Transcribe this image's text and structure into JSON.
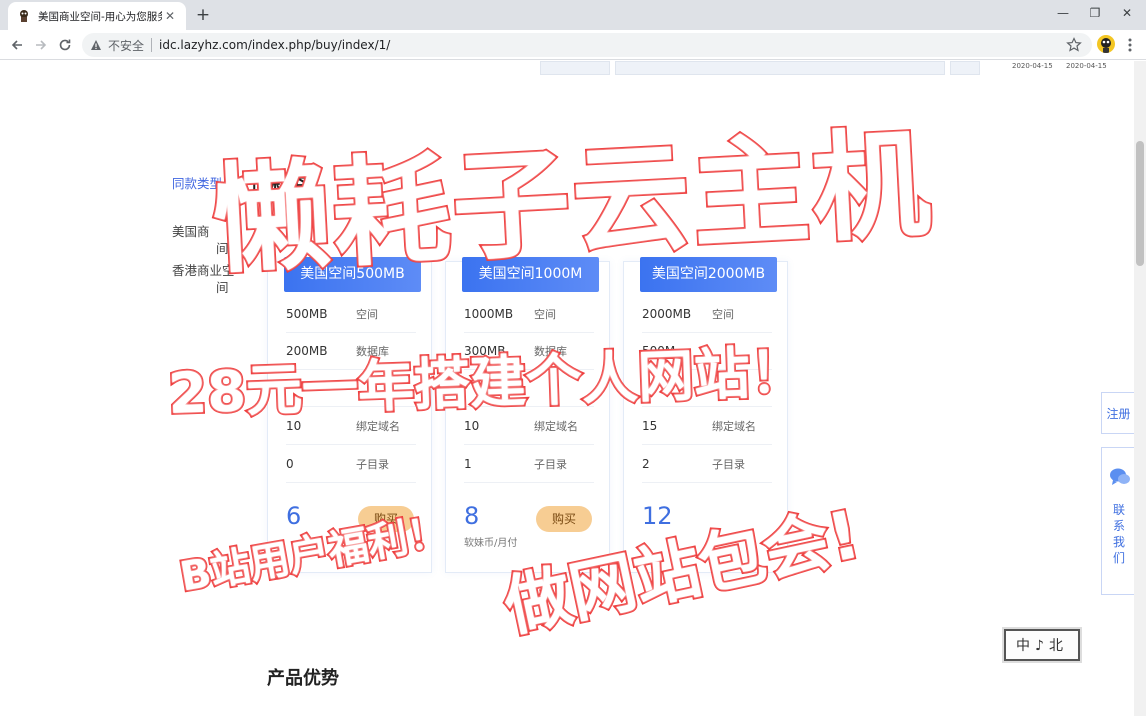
{
  "browser": {
    "tab_title": "美国商业空间-用心为您服务！",
    "new_tab": "+",
    "security_label": "不安全",
    "url": "idc.lazyhz.com/index.php/buy/index/1/",
    "window_min": "—",
    "window_restore": "❐",
    "window_close": "✕",
    "tab_close": "✕"
  },
  "banner": {
    "date1": "2020-04-15",
    "date2": "2020-04-15"
  },
  "category_nav": {
    "active": "同款类型",
    "items": [
      {
        "line1": "美国商",
        "line2": "间"
      },
      {
        "line1": "香港商业空",
        "line2": "间"
      }
    ]
  },
  "section_title": "同款类",
  "cards": [
    {
      "name": "美国空间500MB",
      "rows": [
        {
          "value": "500MB",
          "label": "空间"
        },
        {
          "value": "200MB",
          "label": "数据库"
        },
        {
          "value": "",
          "label": ""
        },
        {
          "value": "10",
          "label": "绑定域名"
        },
        {
          "value": "0",
          "label": "子目录"
        }
      ],
      "price": "6",
      "unit": "",
      "buy": "购买"
    },
    {
      "name": "美国空间1000M",
      "rows": [
        {
          "value": "1000MB",
          "label": "空间"
        },
        {
          "value": "300MB",
          "label": "数据库"
        },
        {
          "value": "",
          "label": ""
        },
        {
          "value": "10",
          "label": "绑定域名"
        },
        {
          "value": "1",
          "label": "子目录"
        }
      ],
      "price": "8",
      "unit": "软妹币/月付",
      "buy": "购买"
    },
    {
      "name": "美国空间2000MB",
      "rows": [
        {
          "value": "2000MB",
          "label": "空间"
        },
        {
          "value": "500M",
          "label": ""
        },
        {
          "value": "",
          "label": ""
        },
        {
          "value": "15",
          "label": "绑定域名"
        },
        {
          "value": "2",
          "label": "子目录"
        }
      ],
      "price": "12",
      "unit": "",
      "buy": "购买"
    }
  ],
  "advantage_title": "产品优势",
  "float": {
    "register": "注册",
    "contact": "联\n系\n我\n们"
  },
  "stamp": "中♪北",
  "overlay": {
    "title": "懒耗子云主机",
    "subtitle": "28元一年搭建个人网站！",
    "bili": "B站用户福利！",
    "package": "做网站包会!"
  },
  "colors": {
    "accent": "#3f6fe0",
    "overlay_stroke": "#ee3b3b",
    "buy_button": "#f7cd93"
  }
}
